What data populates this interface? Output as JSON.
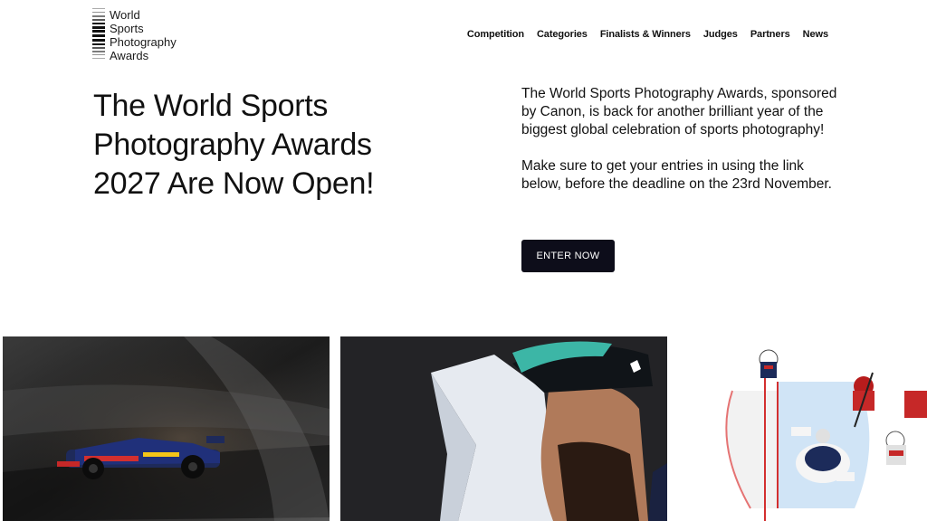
{
  "logo": {
    "lines": [
      "World",
      "Sports",
      "Photography",
      "Awards"
    ]
  },
  "nav": {
    "items": [
      "Competition",
      "Categories",
      "Finalists & Winners",
      "Judges",
      "Partners",
      "News"
    ]
  },
  "hero": {
    "headline_lines": [
      "The World Sports",
      "Photography Awards",
      "2027 Are Now Open!"
    ],
    "paragraph_1": "The World Sports Photography Awards, sponsored by Canon, is back for another brilliant year of the biggest global celebration of sports photography!",
    "paragraph_2": "Make sure to get your entries in using the link below, before the deadline on the 23rd November.",
    "cta_label": "ENTER NOW"
  },
  "gallery": {
    "photos": [
      "f1-car-photo",
      "player-kissing-trophy-photo",
      "ice-hockey-overhead-photo"
    ]
  },
  "colors": {
    "background": "#ffffff",
    "text": "#111111",
    "button": "#0d0d1a"
  }
}
